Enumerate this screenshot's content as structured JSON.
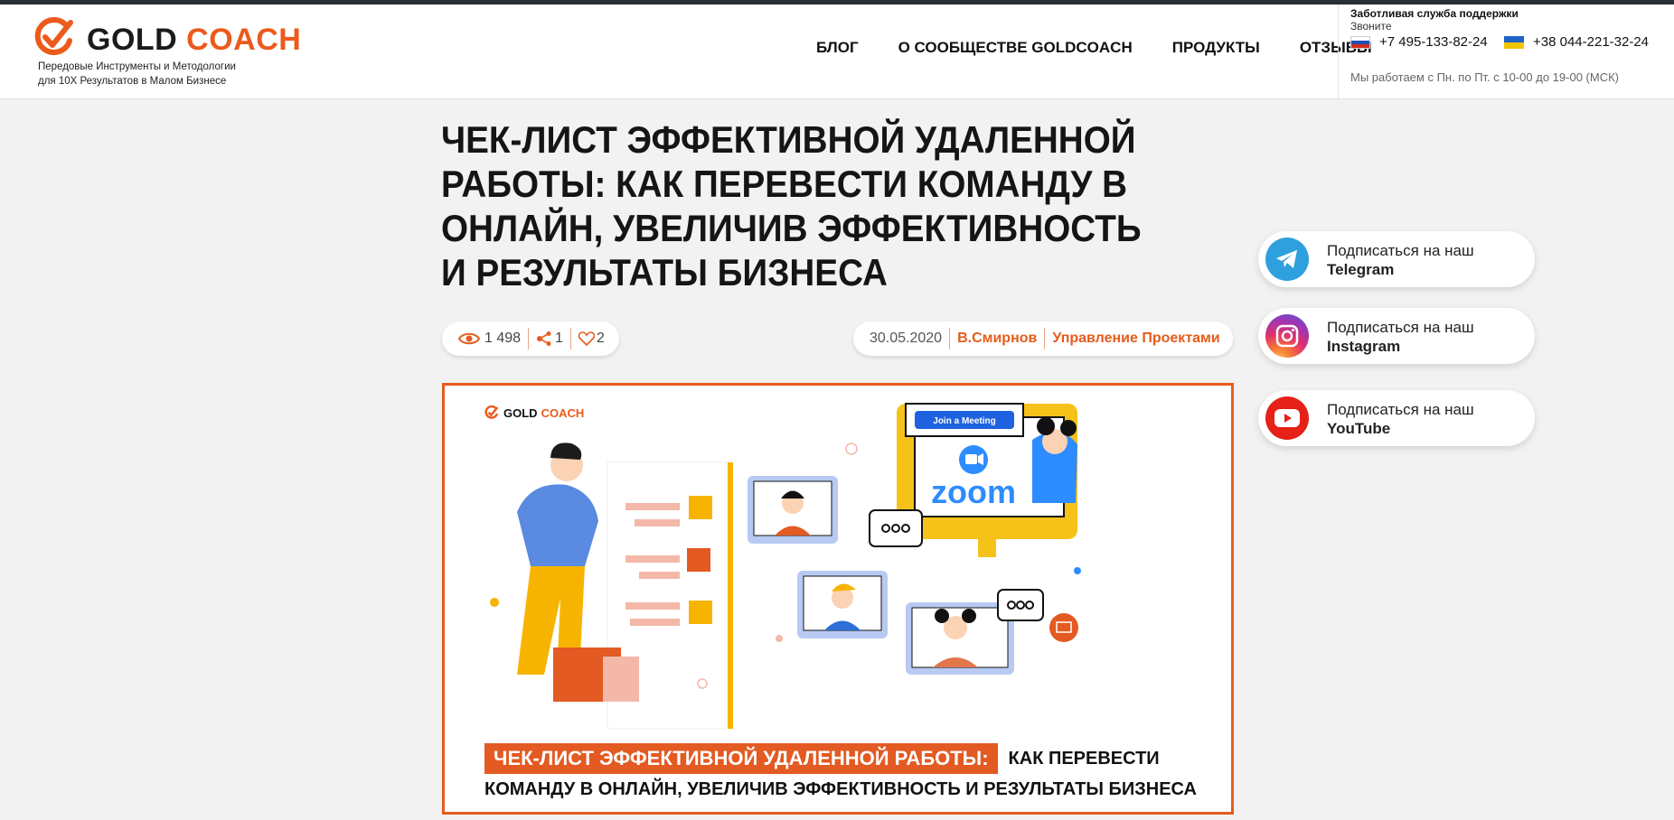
{
  "header": {
    "logo_gold": "GOLD",
    "logo_coach": "COACH",
    "tagline_line1": "Передовые Инструменты и Методологии",
    "tagline_line2": "для 10Х Результатов в Малом Бизнесе",
    "nav": [
      "БЛОГ",
      "О СООБЩЕСТВЕ GOLDCOACH",
      "ПРОДУКТЫ",
      "ОТЗЫВЫ"
    ],
    "support_title": "Заботливая служба поддержки",
    "support_call": "Звоните",
    "phone_ru": "+7 495-133-82-24",
    "phone_ua": "+38 044-221-32-24",
    "hours": "Мы работаем с Пн. по Пт. с 10-00 до 19-00 (МСК)"
  },
  "article": {
    "title": "ЧЕК-ЛИСТ ЭФФЕКТИВНОЙ УДАЛЕННОЙ РАБОТЫ: КАК ПЕРЕВЕСТИ КОМАНДУ В ОНЛАЙН, УВЕЛИЧИВ ЭФФЕКТИВНОСТЬ И РЕЗУЛЬТАТЫ БИЗНЕСА",
    "views": "1 498",
    "shares": "1",
    "likes": "2",
    "date": "30.05.2020",
    "author": "В.Смирнов",
    "category": "Управление Проектами"
  },
  "hero": {
    "logo_gold": "GOLD",
    "logo_coach": "COACH",
    "join_meeting": "Join a Meeting",
    "zoom": "zoom",
    "tag": "ЧЕК-ЛИСТ ЭФФЕКТИВНОЙ УДАЛЕННОЙ РАБОТЫ:",
    "line1_rest": "КАК ПЕРЕВЕСТИ",
    "line2": "КОМАНДУ В ОНЛАЙН, УВЕЛИЧИВ ЭФФЕКТИВНОСТЬ И РЕЗУЛЬТАТЫ БИЗНЕСА"
  },
  "subscribe": [
    {
      "prefix": "Подписаться на наш",
      "name": "Telegram",
      "icon": "telegram-icon"
    },
    {
      "prefix": "Подписаться на наш",
      "name": "Instagram",
      "icon": "instagram-icon"
    },
    {
      "prefix": "Подписаться на наш",
      "name": "YouTube",
      "icon": "youtube-icon"
    }
  ],
  "colors": {
    "accent": "#e65c1c",
    "telegram": "#2ea0dd",
    "youtube": "#e62117"
  }
}
